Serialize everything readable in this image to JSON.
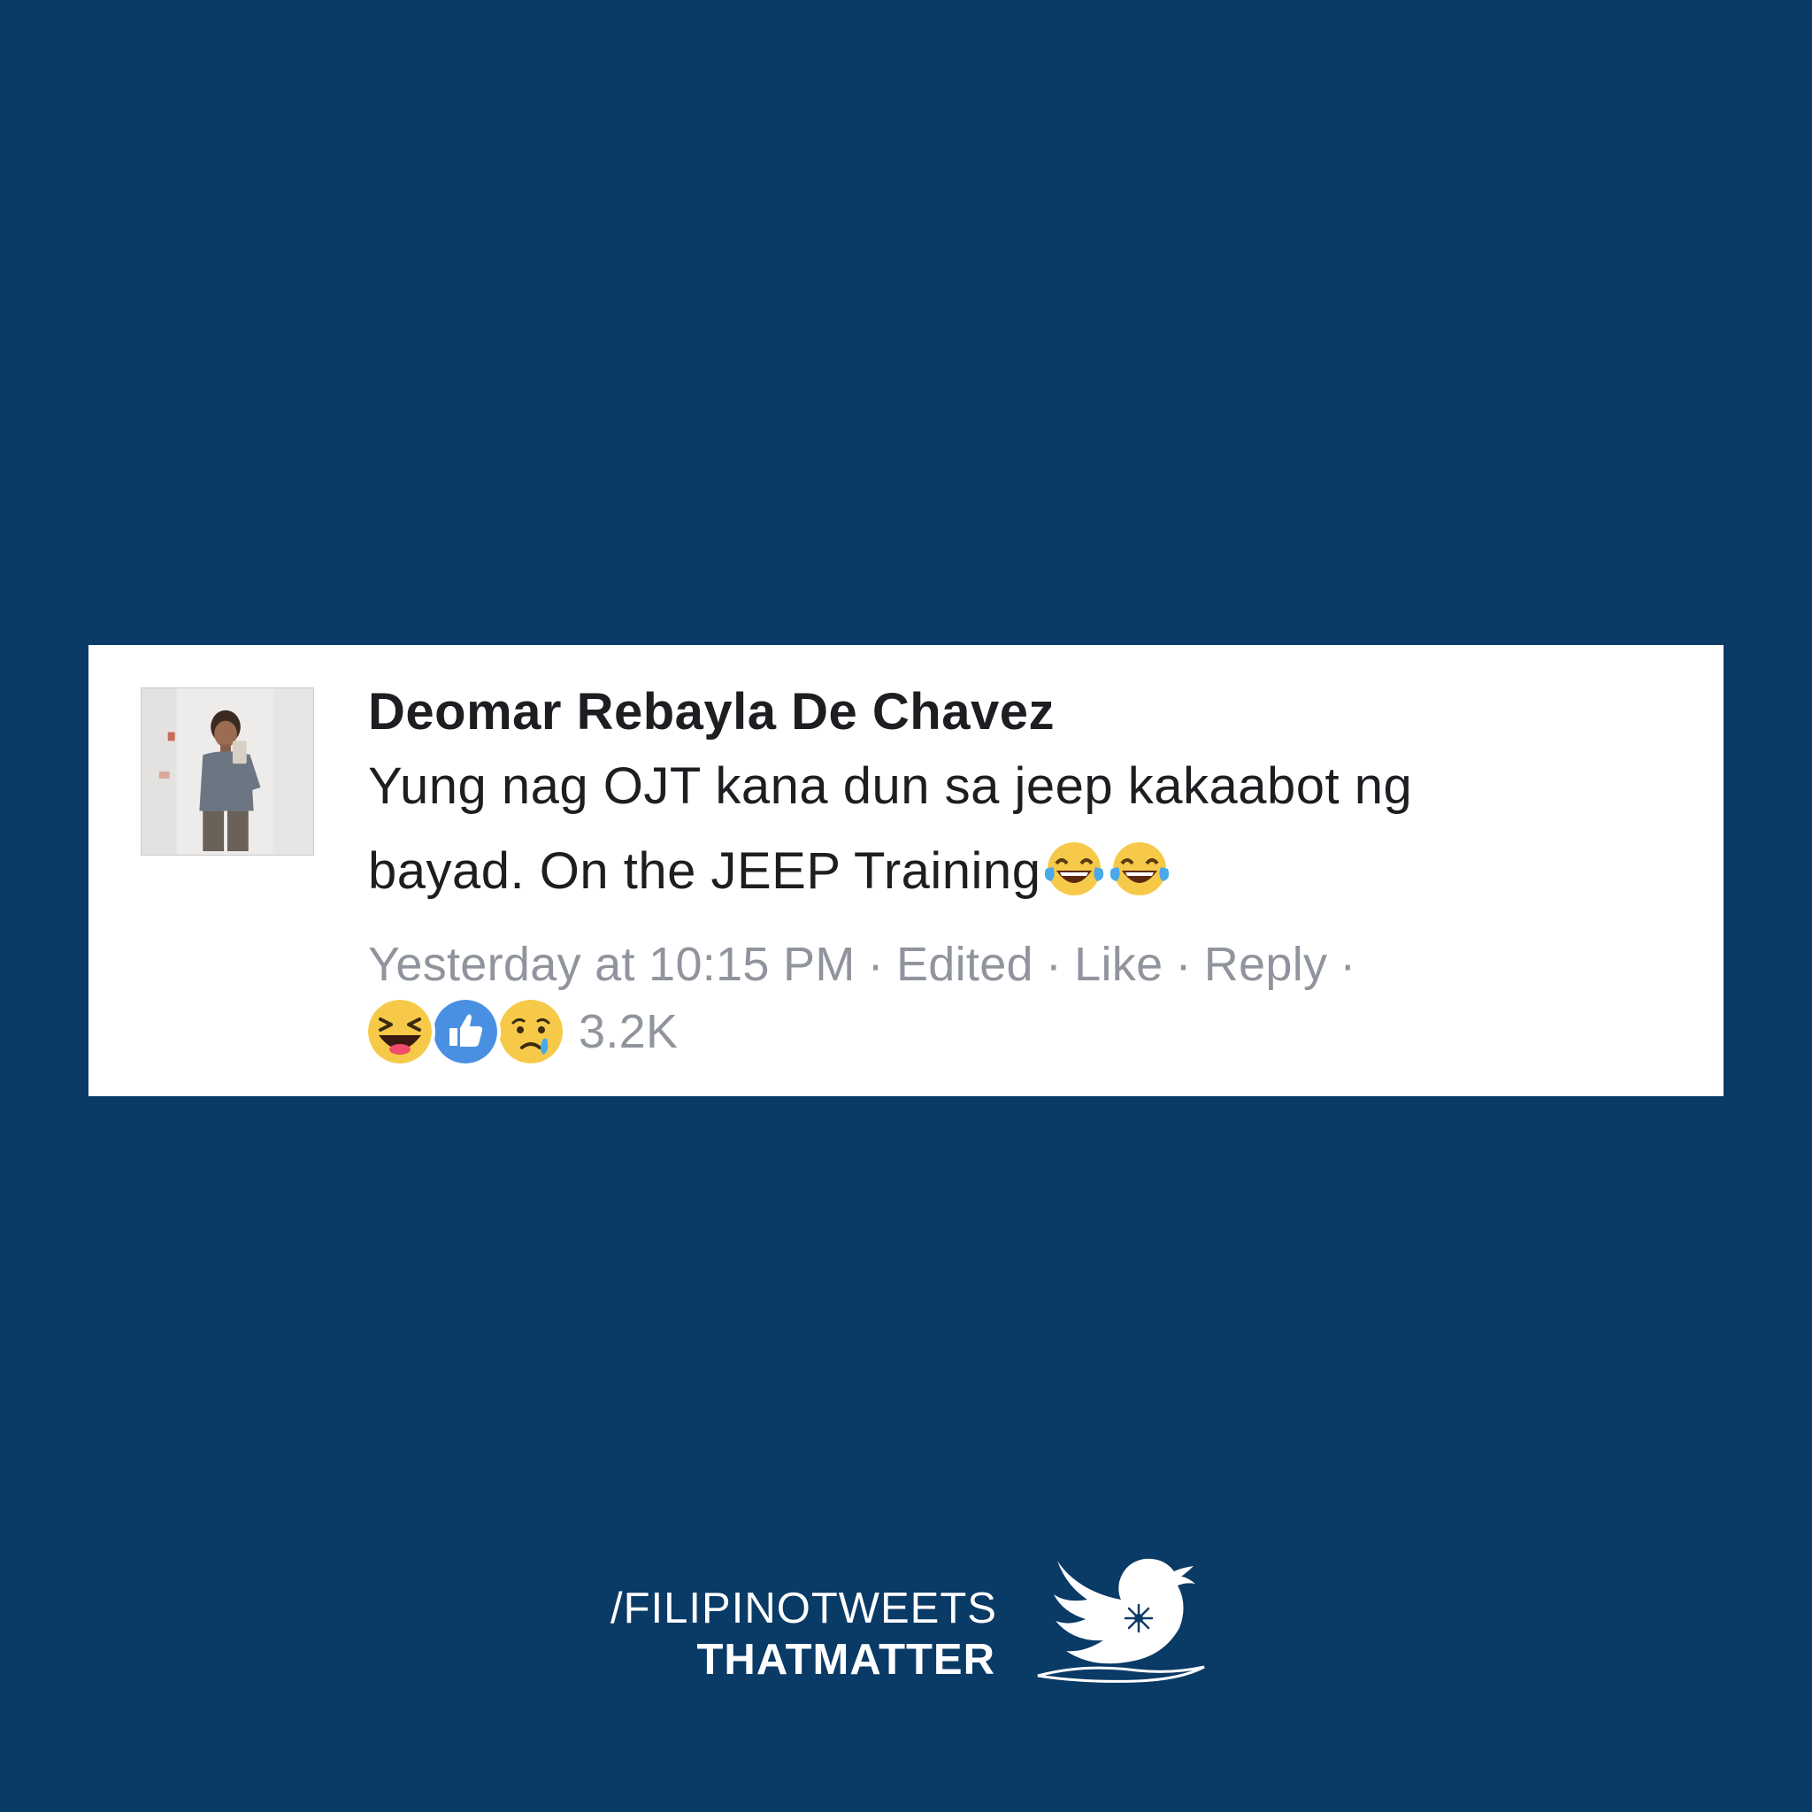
{
  "comment": {
    "author": "Deomar Rebayla De Chavez",
    "text_lines": [
      "Yung nag OJT kana dun sa jeep kakaabot ng",
      "bayad. On the JEEP Training"
    ],
    "trailing_emojis": [
      "face-with-tears-of-joy-icon",
      "face-with-tears-of-joy-icon"
    ],
    "meta": {
      "time": "Yesterday at 10:15 PM",
      "edited": "Edited",
      "like": "Like",
      "reply": "Reply",
      "dot": "·"
    },
    "reactions": {
      "icons": [
        "haha-reaction-icon",
        "like-reaction-icon",
        "sad-reaction-icon"
      ],
      "count": "3.2K"
    }
  },
  "brand": {
    "line1": "/FILIPINOTWEETS",
    "line2": "THATMATTER",
    "logo": "bird-with-sun-icon"
  },
  "colors": {
    "background": "#0a3a66",
    "card": "#ffffff",
    "text": "#1c1e21",
    "meta": "#90949c",
    "like_blue": "#4a90e2",
    "emoji_yellow": "#f7c948"
  }
}
